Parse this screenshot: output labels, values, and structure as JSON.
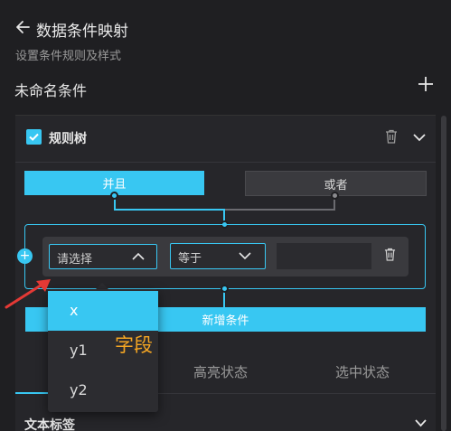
{
  "header": {
    "title": "数据条件映射",
    "subtitle": "设置条件规则及样式"
  },
  "condition": {
    "name": "未命名条件"
  },
  "rule_tree": {
    "label": "规则树",
    "checked": true,
    "logic_and": "并且",
    "logic_or": "或者",
    "field_placeholder": "请选择",
    "operator_value": "等于",
    "value_input": "",
    "add_condition": "新增条件",
    "field_options": [
      "x",
      "y1",
      "y2"
    ],
    "field_selected": "x"
  },
  "tabs": {
    "highlight": "高亮状态",
    "selected": "选中状态"
  },
  "text_section": {
    "label": "文本标签"
  },
  "annotation": {
    "text": "字段"
  },
  "colors": {
    "accent": "#38c7f2",
    "annotation": "#f5a623",
    "arrow": "#e53935"
  }
}
